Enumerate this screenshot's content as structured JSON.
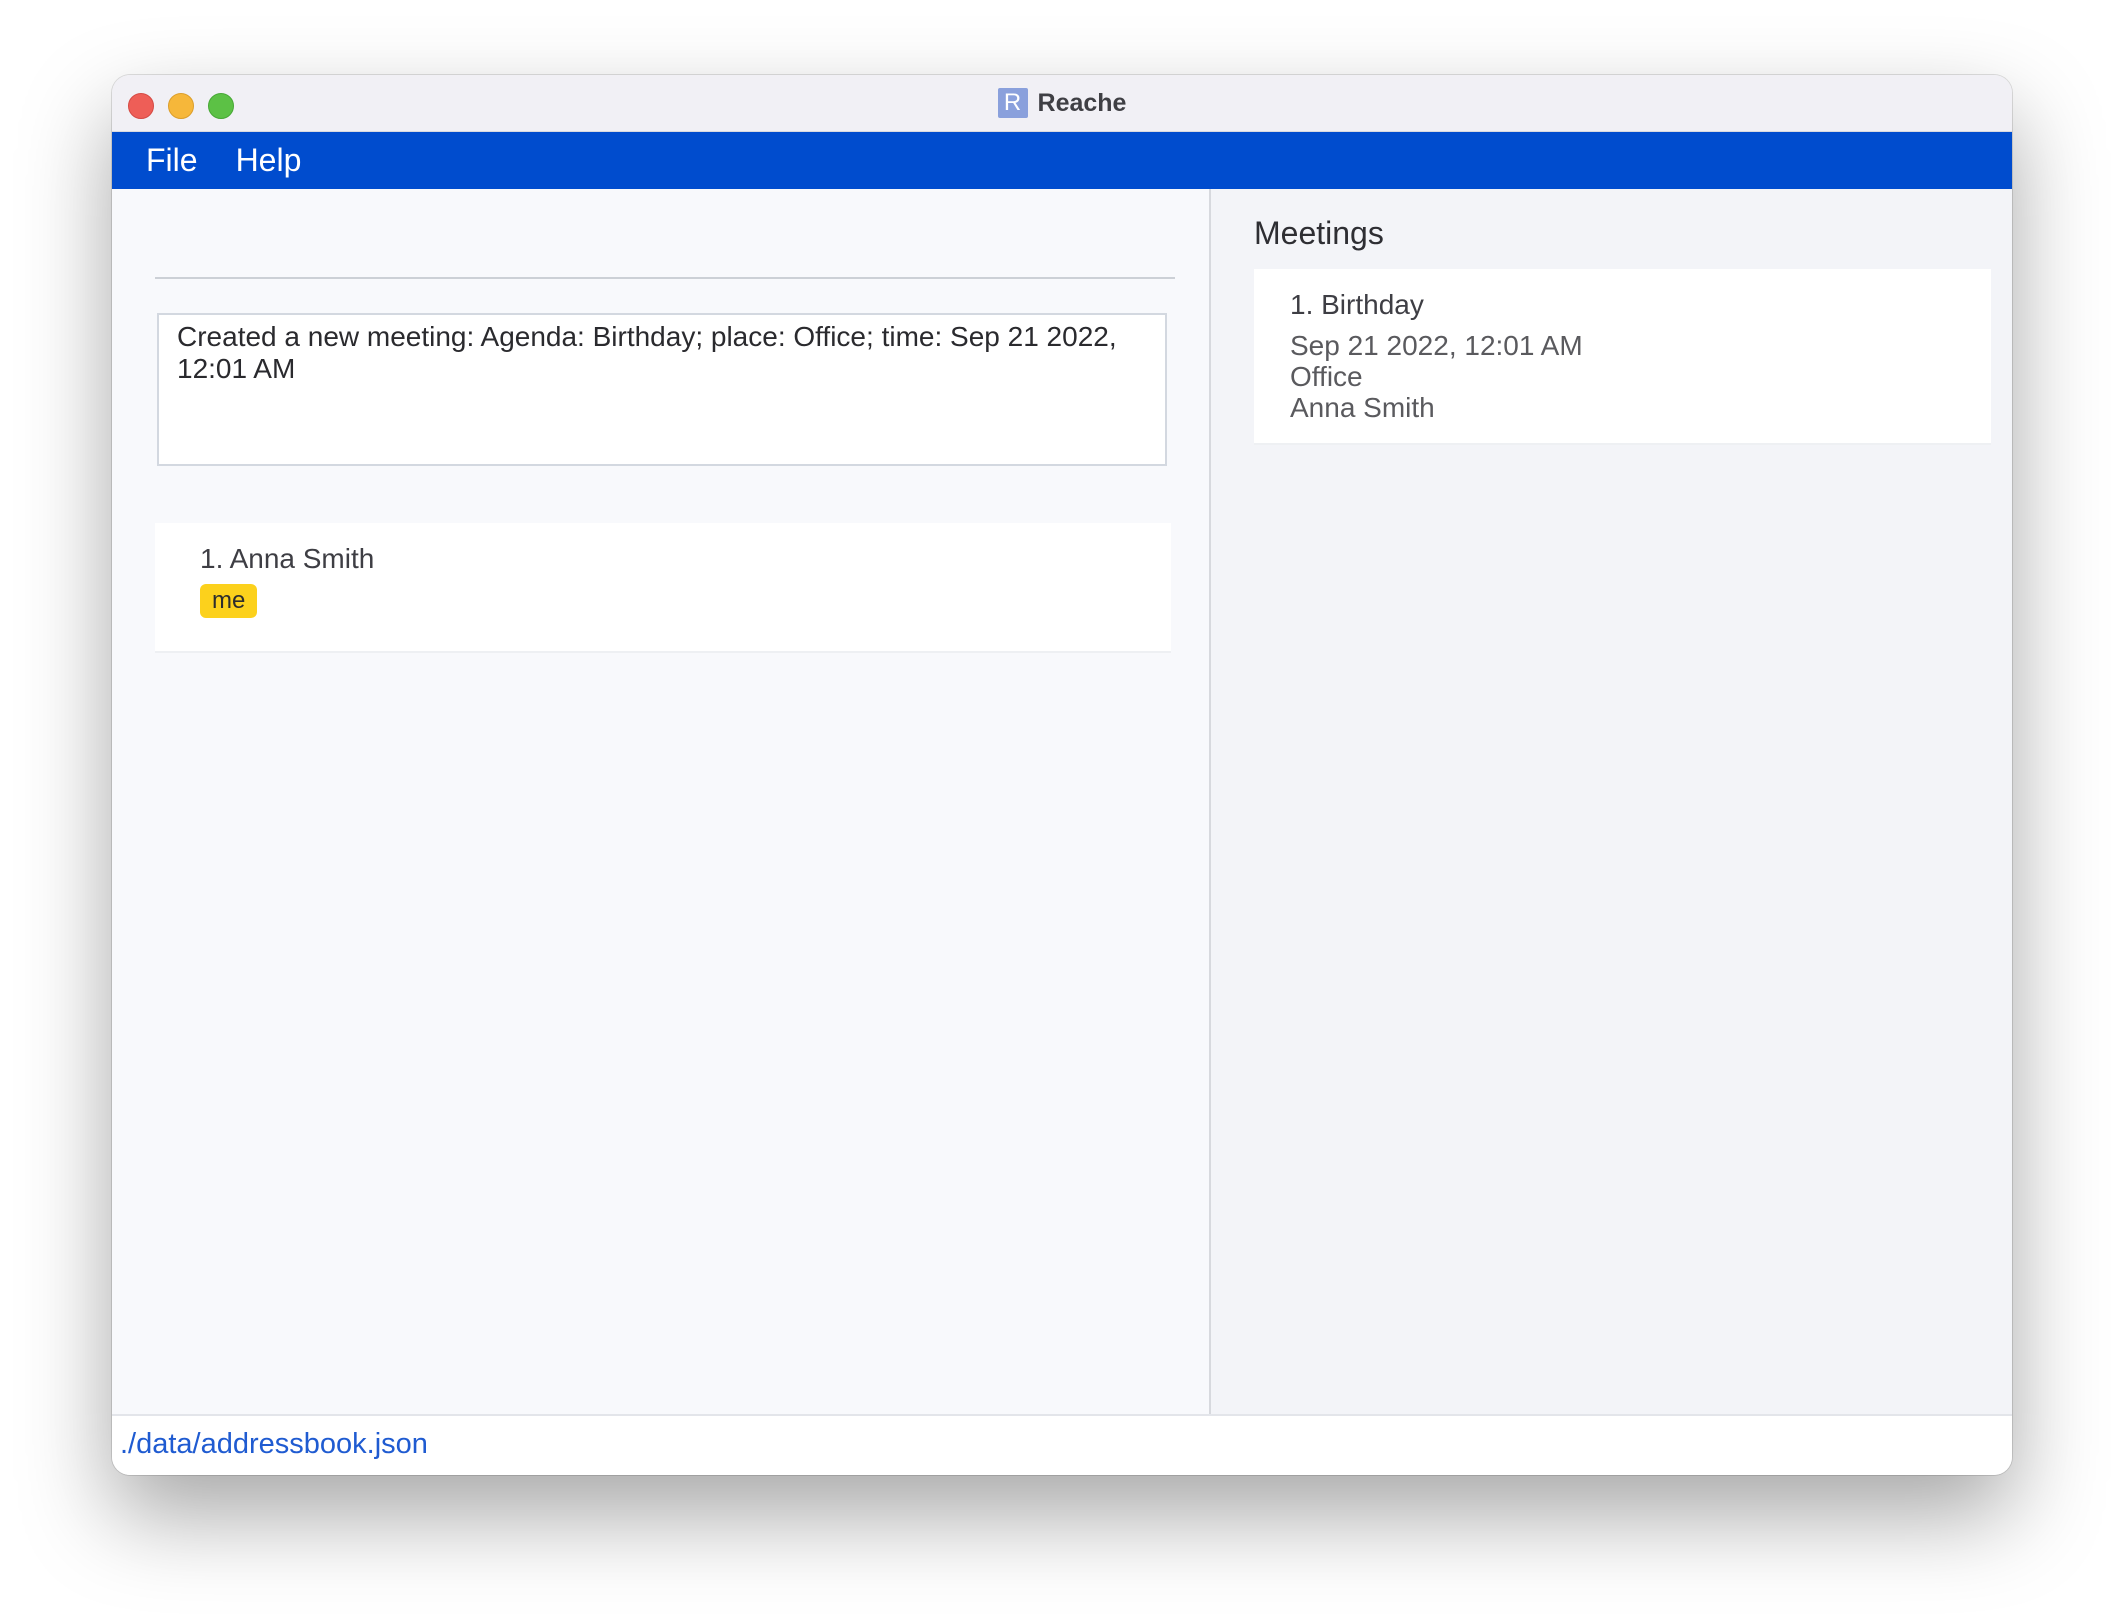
{
  "window": {
    "title": "Reache",
    "app_icon_letter": "R"
  },
  "menubar": {
    "items": [
      {
        "label": "File"
      },
      {
        "label": "Help"
      }
    ]
  },
  "command": {
    "value": "",
    "placeholder": ""
  },
  "result": {
    "text": "Created a new meeting: Agenda: Birthday; place: Office; time: Sep 21 2022, 12:01 AM"
  },
  "people": [
    {
      "name": "1. Anna Smith",
      "tag": "me"
    }
  ],
  "meetings": {
    "heading": "Meetings",
    "items": [
      {
        "title": "1. Birthday",
        "time": "Sep 21 2022, 12:01 AM",
        "place": "Office",
        "attendees": "Anna Smith"
      }
    ]
  },
  "status": {
    "path": "./data/addressbook.json"
  },
  "colors": {
    "menubar": "#004cce",
    "tag": "#fcd11c",
    "status_path": "#1f5bd1"
  }
}
